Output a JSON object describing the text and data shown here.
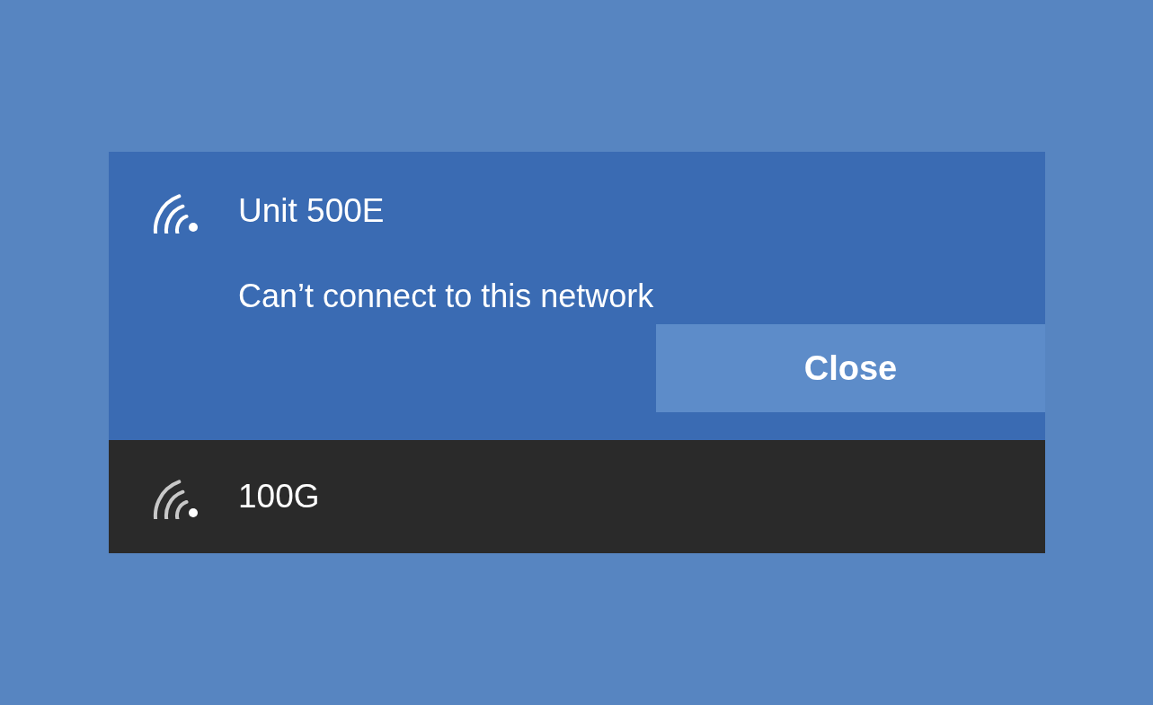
{
  "networks": [
    {
      "name": "Unit 500E",
      "selected": true,
      "message": "Can’t connect to this network",
      "button": "Close"
    },
    {
      "name": "100G",
      "selected": false
    }
  ]
}
